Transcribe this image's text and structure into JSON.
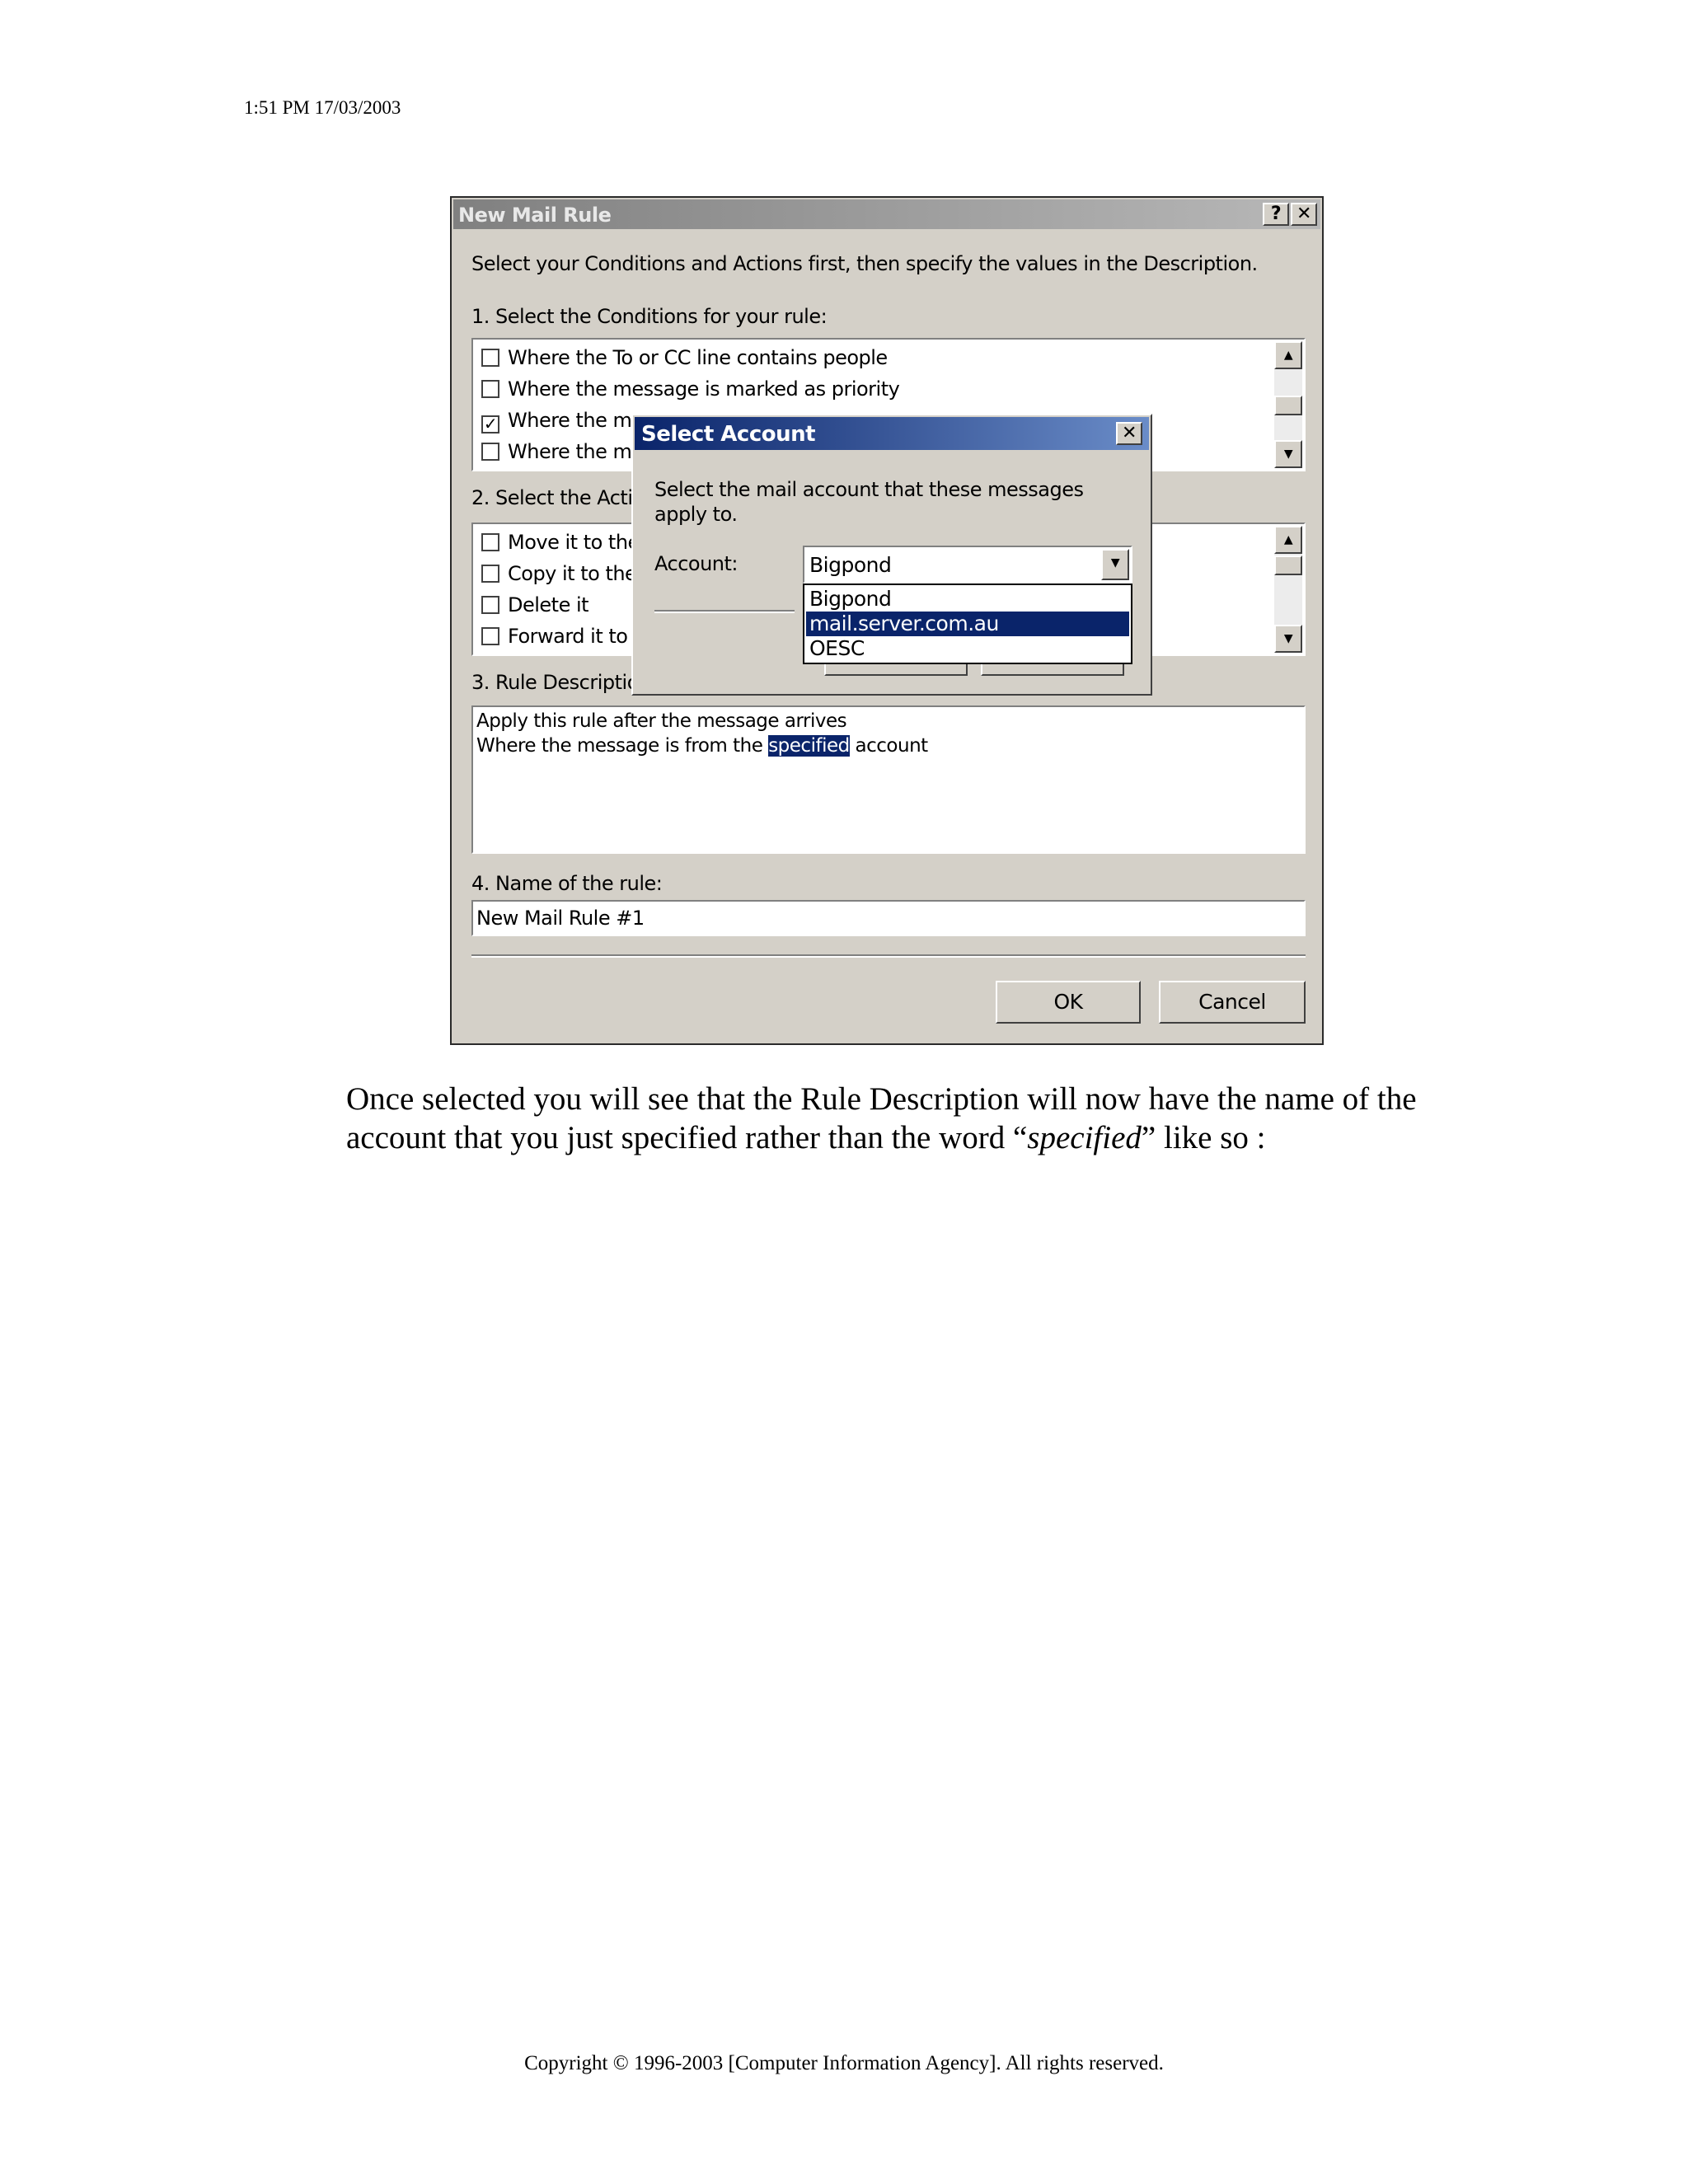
{
  "page": {
    "timestamp": "1:51 PM 17/03/2003",
    "paragraph_before": "Once selected you will see that the Rule Description will now have the name of the account that you just specified rather than the word “",
    "paragraph_italic": "specified",
    "paragraph_after": "” like so :",
    "footer": "Copyright © 1996-2003 [Computer Information Agency]. All rights reserved."
  },
  "dialog": {
    "title": "New Mail Rule",
    "help_glyph": "?",
    "close_glyph": "✕",
    "instructions": "Select your Conditions and Actions first, then specify the values in the Description.",
    "conditions_label": "1. Select the Conditions for your rule:",
    "conditions": [
      {
        "label": "Where the To or CC line contains people",
        "check": ""
      },
      {
        "label": "Where the message is marked as priority",
        "check": ""
      },
      {
        "label": "Where the m",
        "check": "✓"
      },
      {
        "label": "Where the m",
        "check": ""
      }
    ],
    "actions_label": "2. Select the Actic",
    "actions": [
      {
        "label": "Move it to the",
        "check": ""
      },
      {
        "label": "Copy it to the",
        "check": ""
      },
      {
        "label": "Delete it",
        "check": ""
      },
      {
        "label": "Forward it to",
        "check": ""
      }
    ],
    "description_label": "3. Rule Descriptio",
    "description_line1": "Apply this rule after the message arrives",
    "description_line2_before": "Where the message is from the ",
    "description_link": "specified",
    "description_line2_after": " account",
    "name_label": "4. Name of the rule:",
    "name_value": "New Mail Rule #1",
    "ok_label": "OK",
    "cancel_label": "Cancel",
    "scroll_up": "▲",
    "scroll_down": "▼"
  },
  "select_account": {
    "title": "Select Account",
    "close_glyph": "✕",
    "prompt_line1": "Select the mail account that these messages",
    "prompt_line2": "apply to.",
    "account_label": "Account:",
    "selected_value": "Bigpond",
    "dropdown_glyph": "▼",
    "options": [
      "Bigpond",
      "mail.server.com.au",
      "OESC"
    ],
    "highlighted_option": "mail.server.com.au"
  },
  "colors": {
    "selection": "#0a246a",
    "dialog_face": "#d4d0c8"
  }
}
